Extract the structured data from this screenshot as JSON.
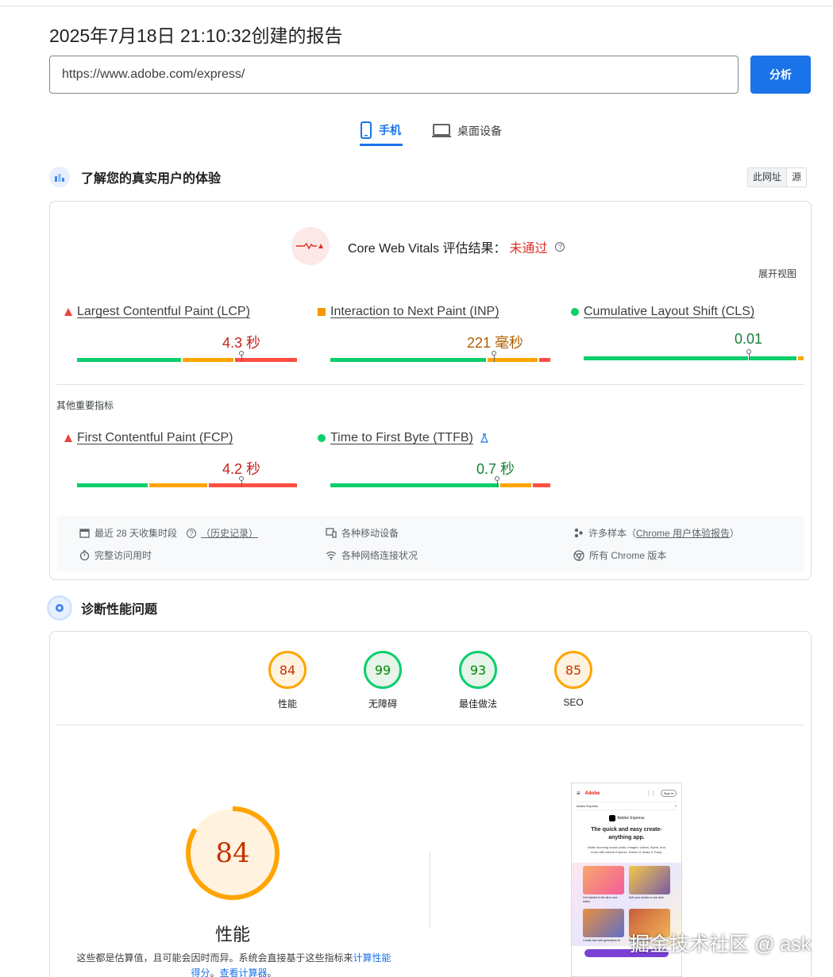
{
  "report": {
    "title": "2025年7月18日 21:10:32创建的报告",
    "url_value": "https://www.adobe.com/express/",
    "analyze_label": "分析"
  },
  "tabs": [
    {
      "label": "手机",
      "icon": "phone-icon",
      "active": true
    },
    {
      "label": "桌面设备",
      "icon": "desktop-icon",
      "active": false
    }
  ],
  "field": {
    "heading": "了解您的真实用户的体验",
    "toggle": [
      "此网址",
      "源"
    ],
    "cwv_label": "Core Web Vitals 评估结果：",
    "cwv_status": "未通过",
    "expand_label": "展开视图",
    "metrics": [
      {
        "name": "Largest Contentful Paint (LCP)",
        "value": "4.3 秒",
        "status": "poor"
      },
      {
        "name": "Interaction to Next Paint (INP)",
        "value": "221 毫秒",
        "status": "needs-improvement"
      },
      {
        "name": "Cumulative Layout Shift (CLS)",
        "value": "0.01",
        "status": "good"
      }
    ],
    "other_label": "其他重要指标",
    "other_metrics": [
      {
        "name": "First Contentful Paint (FCP)",
        "value": "4.2 秒",
        "status": "poor"
      },
      {
        "name": "Time to First Byte (TTFB)",
        "value": "0.7 秒",
        "status": "good"
      }
    ],
    "info": {
      "period": "最近 28 天收集时段",
      "history": "（历史记录）",
      "devices": "各种移动设备",
      "samples_prefix": "许多样本（",
      "samples_link": "Chrome 用户体验报告",
      "samples_suffix": "）",
      "visits": "完整访问用时",
      "network": "各种网络连接状况",
      "chrome": "所有 Chrome 版本"
    }
  },
  "diagnose": {
    "heading": "诊断性能问题",
    "scores": [
      {
        "value": "84",
        "label": "性能",
        "level": "average"
      },
      {
        "value": "99",
        "label": "无障碍",
        "level": "pass"
      },
      {
        "value": "93",
        "label": "最佳做法",
        "level": "pass"
      },
      {
        "value": "85",
        "label": "SEO",
        "level": "average"
      }
    ],
    "perf_score": "84",
    "perf_fraction": 0.84,
    "perf_title": "性能",
    "perf_desc_prefix": "这些都是估算值，且可能会因时而异。系统会直接基于这些指标来",
    "perf_desc_link1": "计算性能得分",
    "perf_desc_mid": "。",
    "perf_desc_link2": "查看计算器",
    "perf_desc_end": "。"
  },
  "screenshot": {
    "brand": "Adobe",
    "signin": "Sign in",
    "nav": "Adobe Express",
    "app_name": "Adobe Express",
    "headline": "The quick and easy create-anything app.",
    "body": "Make stunning social posts, images, videos, flyers, and more with Adobe Express. Dream it. Make it. Easy.",
    "cards": [
      "Get started in the all-in-one editor",
      "Edit your media in one click",
      "Create fast with generative AI",
      "Explore amazing content"
    ]
  },
  "watermark": "掘金技术社区 @ ask",
  "colors": {
    "accent": "#1a73e8",
    "good": "#0cce6b",
    "average": "#ffa400",
    "poor": "#ff4e42"
  }
}
